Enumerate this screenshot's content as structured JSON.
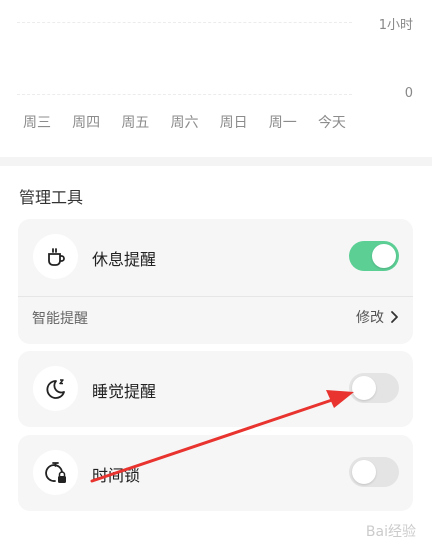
{
  "chart": {
    "y_top_label": "1小时",
    "y_zero_label": "0",
    "days": [
      "周三",
      "周四",
      "周五",
      "周六",
      "周日",
      "周一",
      "今天"
    ]
  },
  "chart_data": {
    "type": "bar",
    "categories": [
      "周三",
      "周四",
      "周五",
      "周六",
      "周日",
      "周一",
      "今天"
    ],
    "values": [
      0,
      0,
      0,
      0,
      0,
      0,
      0
    ],
    "ylim": [
      0,
      1
    ]
  },
  "tools": {
    "title": "管理工具",
    "rest_reminder": {
      "label": "休息提醒",
      "enabled": true,
      "icon": "cup-icon"
    },
    "smart_reminder": {
      "label": "智能提醒",
      "action": "修改"
    },
    "sleep_reminder": {
      "label": "睡觉提醒",
      "enabled": false,
      "icon": "moon-icon"
    },
    "time_lock": {
      "label": "时间锁",
      "enabled": false,
      "icon": "timer-lock-icon"
    }
  },
  "colors": {
    "toggle_on": "#5ccf95",
    "toggle_off": "#e4e4e4",
    "annotation_arrow": "#e8332f"
  },
  "watermark": "Bai经验"
}
